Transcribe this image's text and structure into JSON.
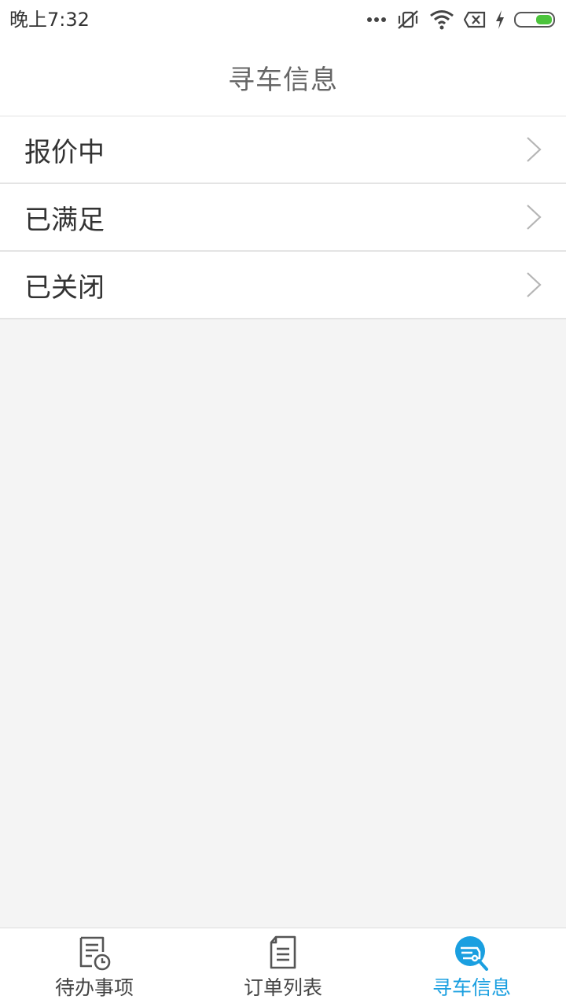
{
  "status_bar": {
    "time": "晚上7:32",
    "icons": [
      "more-dots-icon",
      "vibrate-off-icon",
      "wifi-icon",
      "sim-none-icon",
      "charging-icon",
      "battery-icon"
    ],
    "battery_color": "#4cc43c"
  },
  "header": {
    "title": "寻车信息"
  },
  "menu": {
    "items": [
      {
        "label": "报价中"
      },
      {
        "label": "已满足"
      },
      {
        "label": "已关闭"
      }
    ]
  },
  "tab_bar": {
    "active_color": "#1a9fe0",
    "tabs": [
      {
        "label": "待办事项",
        "icon": "todo-clock-icon",
        "active": false
      },
      {
        "label": "订单列表",
        "icon": "order-document-icon",
        "active": false
      },
      {
        "label": "寻车信息",
        "icon": "car-search-icon",
        "active": true
      }
    ]
  }
}
